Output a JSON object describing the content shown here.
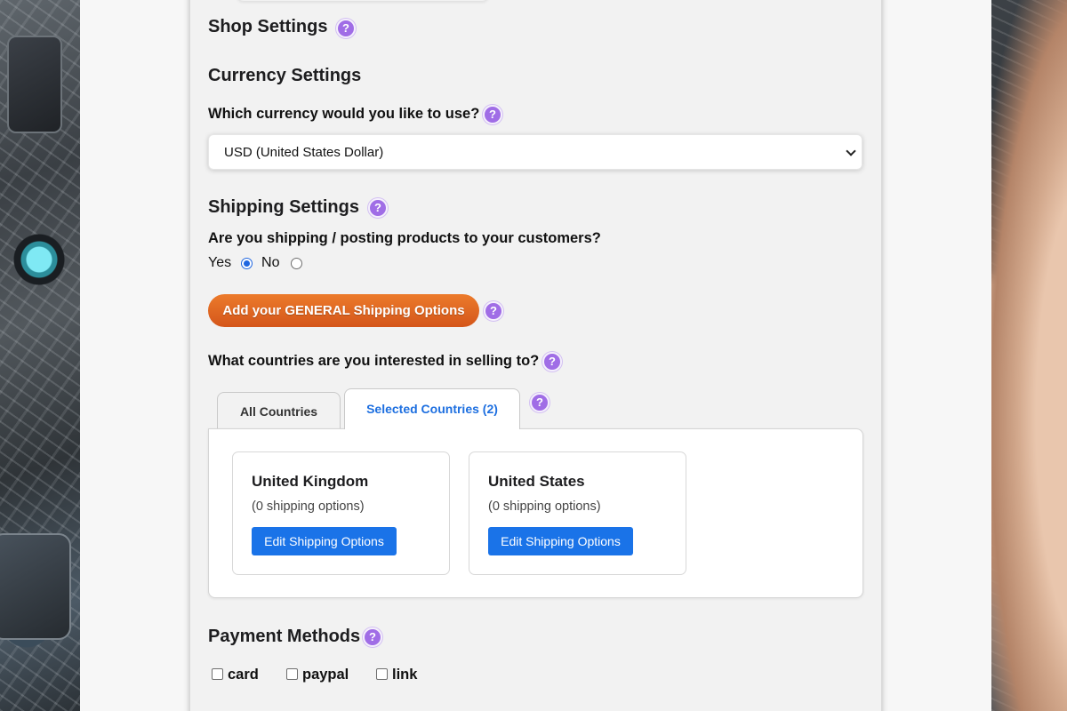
{
  "shop": {
    "title": "Shop Settings"
  },
  "currency": {
    "title": "Currency Settings",
    "question": "Which currency would you like to use?",
    "selected": "USD (United States Dollar)"
  },
  "shipping": {
    "title": "Shipping Settings",
    "question": "Are you shipping / posting products to your customers?",
    "yes_label": "Yes",
    "no_label": "No",
    "selected_option": "Yes",
    "general_button": "Add your GENERAL Shipping Options",
    "countries_question": "What countries are you interested in selling to?",
    "tabs": [
      {
        "label": "All Countries",
        "active": false
      },
      {
        "label": "Selected Countries (2)",
        "active": true
      }
    ],
    "countries": [
      {
        "name": "United Kingdom",
        "options": "(0 shipping options)",
        "button": "Edit Shipping Options"
      },
      {
        "name": "United States",
        "options": "(0 shipping options)",
        "button": "Edit Shipping Options"
      }
    ]
  },
  "payment": {
    "title": "Payment Methods",
    "methods": [
      {
        "label": "card",
        "checked": false
      },
      {
        "label": "paypal",
        "checked": false
      },
      {
        "label": "link",
        "checked": false
      }
    ]
  },
  "help_glyph": "?",
  "colors": {
    "help_icon": "#a06de6",
    "orange_button": "#e06a22",
    "primary_blue": "#1a73e8",
    "active_tab_text": "#1d6fe0"
  }
}
